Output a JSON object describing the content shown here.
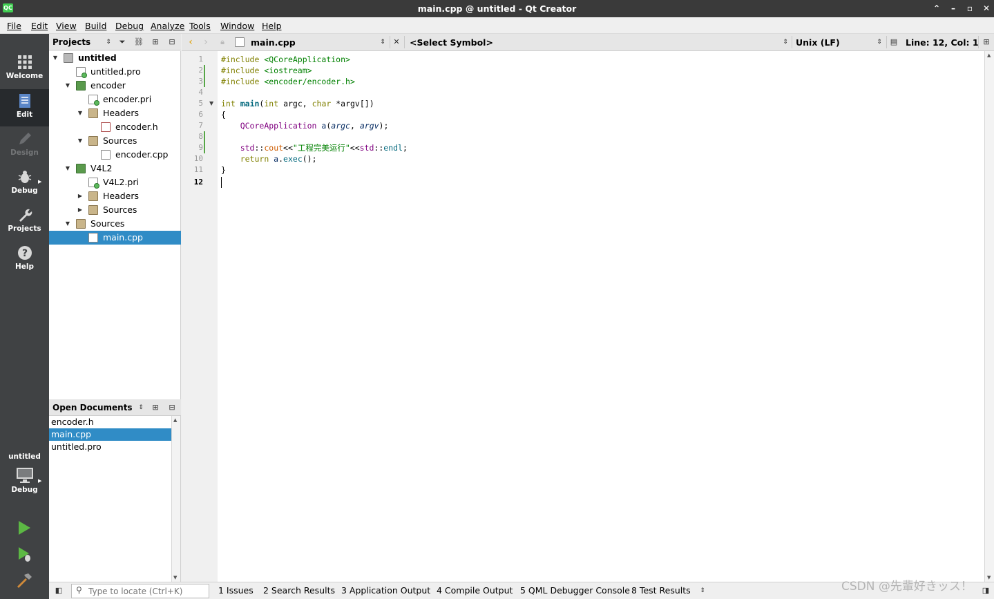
{
  "window": {
    "title": "main.cpp @ untitled - Qt Creator",
    "app_icon": "QC"
  },
  "menu": [
    "File",
    "Edit",
    "View",
    "Build",
    "Debug",
    "Analyze",
    "Tools",
    "Window",
    "Help"
  ],
  "modes": [
    {
      "label": "Welcome",
      "icon": "grid-icon"
    },
    {
      "label": "Edit",
      "icon": "document-icon"
    },
    {
      "label": "Design",
      "icon": "pencil-icon"
    },
    {
      "label": "Debug",
      "icon": "bug-icon"
    },
    {
      "label": "Projects",
      "icon": "wrench-icon"
    },
    {
      "label": "Help",
      "icon": "help-icon"
    }
  ],
  "kit": {
    "project": "untitled",
    "config": "Debug"
  },
  "projects_panel": {
    "title": "Projects",
    "tree": [
      {
        "label": "untitled"
      },
      {
        "label": "untitled.pro"
      },
      {
        "label": "encoder"
      },
      {
        "label": "encoder.pri"
      },
      {
        "label": "Headers"
      },
      {
        "label": "encoder.h"
      },
      {
        "label": "Sources"
      },
      {
        "label": "encoder.cpp"
      },
      {
        "label": "V4L2"
      },
      {
        "label": "V4L2.pri"
      },
      {
        "label": "Headers"
      },
      {
        "label": "Sources"
      },
      {
        "label": "Sources"
      },
      {
        "label": "main.cpp"
      }
    ]
  },
  "open_documents": {
    "title": "Open Documents",
    "items": [
      "encoder.h",
      "main.cpp",
      "untitled.pro"
    ]
  },
  "editor": {
    "file": "main.cpp",
    "symbol": "<Select Symbol>",
    "line_ending": "Unix (LF)",
    "position": "Line: 12, Col: 1",
    "line_numbers": [
      "1",
      "2",
      "3",
      "4",
      "5",
      "6",
      "7",
      "8",
      "9",
      "10",
      "11",
      "12"
    ],
    "code": {
      "l1_dir": "#include",
      "l1_inc": "<QCoreApplication>",
      "l2_dir": "#include",
      "l2_inc": "<iostream>",
      "l3_dir": "#include",
      "l3_inc": "<encoder/encoder.h>",
      "l5_type": "int",
      "l5_fn": "main",
      "l5_open": "(",
      "l5_int": "int",
      "l5_argc": " argc, ",
      "l5_char": "char",
      "l5_rest": " *argv[])",
      "l6": "{",
      "l7_cls": "QCoreApplication",
      "l7_obj": " a",
      "l7_p1": "(",
      "l7_argc": "argc",
      "l7_comma": ", ",
      "l7_argv": "argv",
      "l7_end": ");",
      "l9_ns": "std",
      "l9_sc1": "::",
      "l9_cout": "cout",
      "l9_op1": "<<",
      "l9_str": "\"工程完美运行\"",
      "l9_op2": "<<",
      "l9_ns2": "std",
      "l9_sc2": "::",
      "l9_endl": "endl",
      "l9_semi": ";",
      "l10_kw": "return",
      "l10_obj": " a",
      "l10_dot": ".",
      "l10_fn": "exec",
      "l10_end": "();",
      "l11": "}"
    }
  },
  "status": {
    "locator_placeholder": "Type to locate (Ctrl+K)",
    "panes": [
      "1  Issues",
      "2  Search Results",
      "3  Application Output",
      "4  Compile Output",
      "5  QML Debugger Console",
      "8  Test Results"
    ]
  },
  "watermark": "CSDN @先輩好きッス！"
}
